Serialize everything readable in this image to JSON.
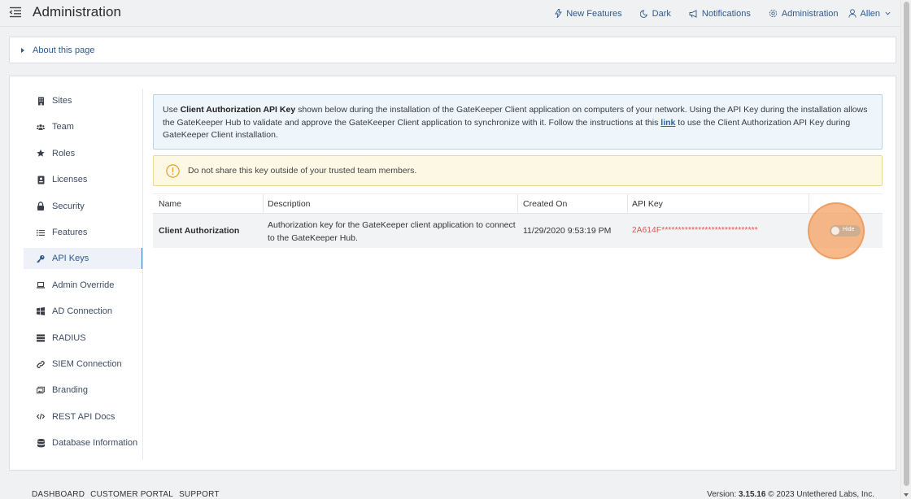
{
  "header": {
    "title": "Administration",
    "nav": {
      "new_features": "New Features",
      "dark": "Dark",
      "notifications": "Notifications",
      "administration": "Administration",
      "user": "Allen"
    }
  },
  "about": {
    "label": "About this page"
  },
  "sidebar": {
    "items": [
      {
        "label": "Sites",
        "icon": "building-icon"
      },
      {
        "label": "Team",
        "icon": "users-icon"
      },
      {
        "label": "Roles",
        "icon": "star-icon"
      },
      {
        "label": "Licenses",
        "icon": "id-card-icon"
      },
      {
        "label": "Security",
        "icon": "lock-icon"
      },
      {
        "label": "Features",
        "icon": "list-icon"
      },
      {
        "label": "API Keys",
        "icon": "key-icon",
        "active": true
      },
      {
        "label": "Admin Override",
        "icon": "laptop-icon"
      },
      {
        "label": "AD Connection",
        "icon": "windows-icon"
      },
      {
        "label": "RADIUS",
        "icon": "server-icon"
      },
      {
        "label": "SIEM Connection",
        "icon": "link-icon"
      },
      {
        "label": "Branding",
        "icon": "images-icon"
      },
      {
        "label": "REST API Docs",
        "icon": "code-icon"
      },
      {
        "label": "Database Information",
        "icon": "database-icon"
      }
    ]
  },
  "info": {
    "p1": "Use ",
    "bold": "Client Authorization API Key",
    "p2": " shown below during the installation of the GateKeeper Client application on computers of your network. Using the API Key during the installation allows the GateKeeper Hub to validate and approve the GateKeeper Client application to synchronize with it. Follow the instructions at this ",
    "link": "link",
    "p3": " to use the Client Authorization API Key during GateKeeper Client installation."
  },
  "warning": {
    "text": "Do not share this key outside of your trusted team members."
  },
  "table": {
    "headers": {
      "name": "Name",
      "description": "Description",
      "created_on": "Created On",
      "api_key": "API Key"
    },
    "rows": [
      {
        "name": "Client Authorization",
        "description": "Authorization key for the GateKeeper client application to connect to the GateKeeper Hub.",
        "created_on": "11/29/2020 9:53:19 PM",
        "api_key": "2A614F*****************************",
        "toggle_label": "Hide"
      }
    ]
  },
  "footer": {
    "links": {
      "dashboard": "DASHBOARD",
      "portal": "CUSTOMER PORTAL",
      "support": "SUPPORT"
    },
    "version_label": "Version: ",
    "version": "3.15.16",
    "copyright": " © 2023 ",
    "company": "Untethered Labs, Inc."
  },
  "colors": {
    "accent": "#2e5a8a",
    "active_border": "#3f76b9",
    "key_red": "#d9534f",
    "highlight": "#f4a261"
  }
}
